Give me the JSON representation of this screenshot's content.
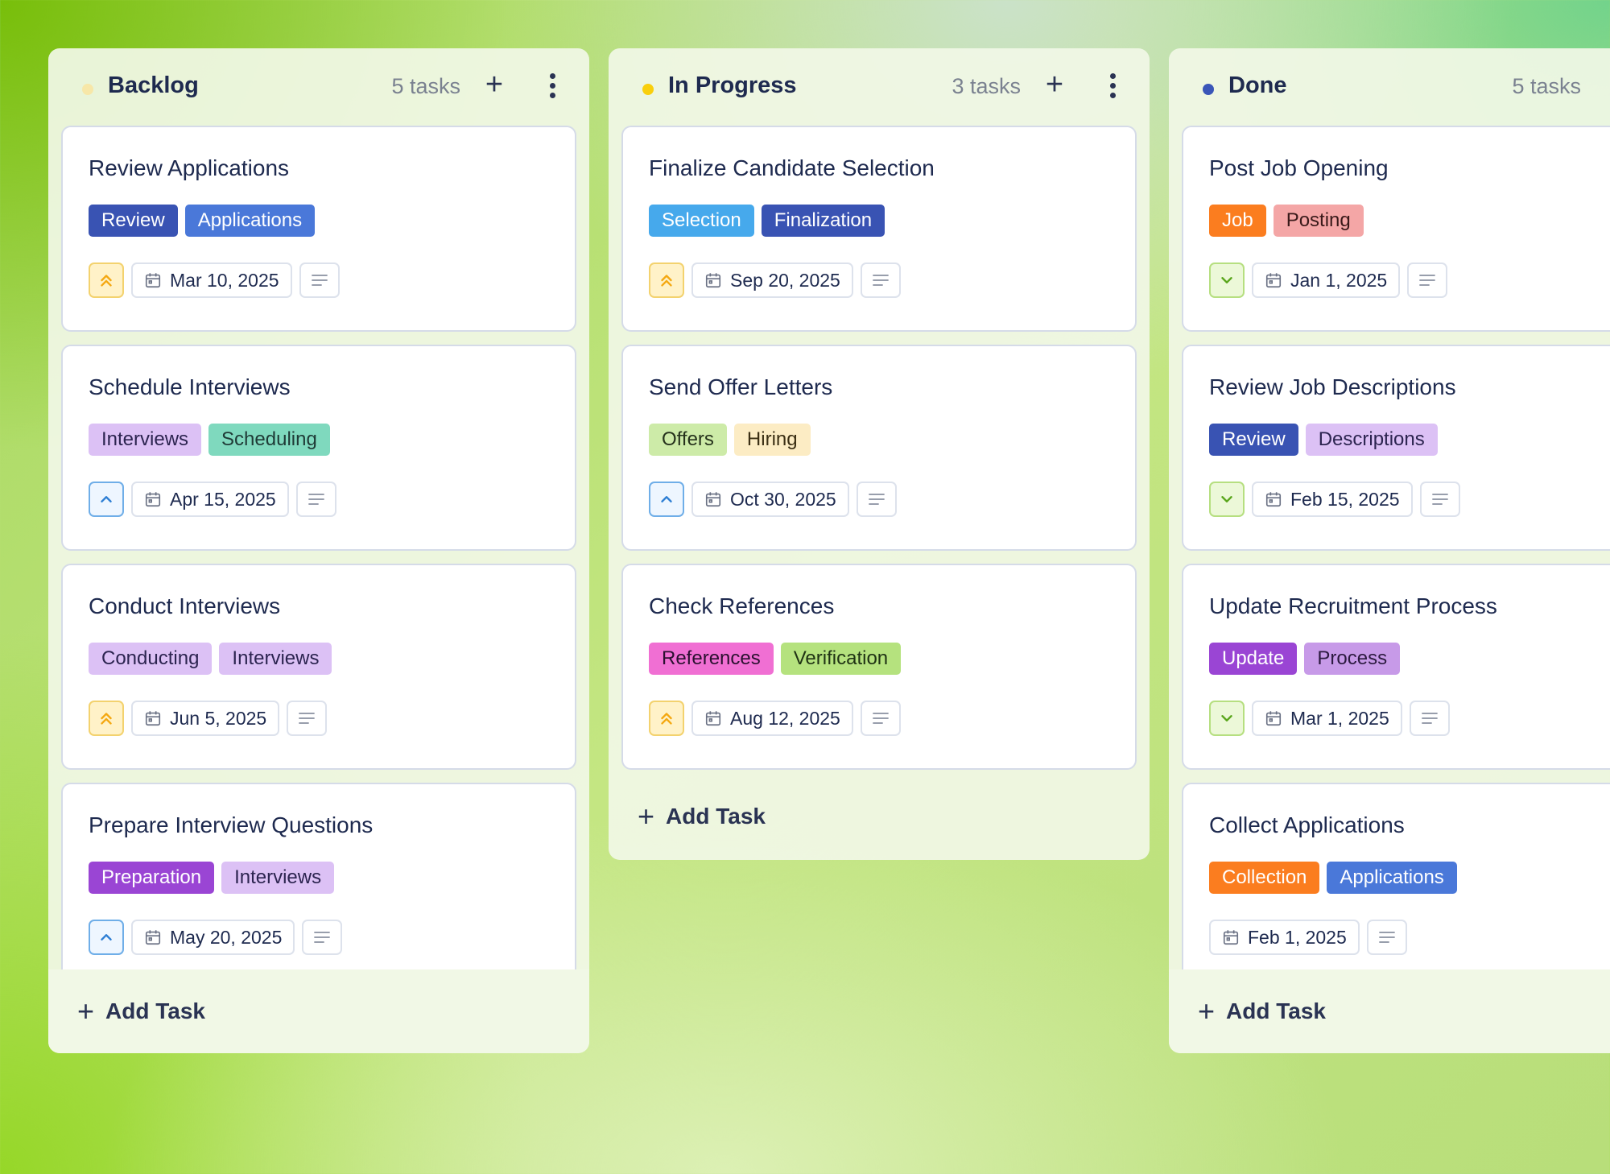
{
  "colors": {
    "backlog_dot": "#f7e7a8",
    "progress_dot": "#f9cf0c",
    "done_dot": "#3a56b8",
    "tag_review": "#3953b3",
    "tag_applications": "#4a78d9",
    "tag_interviews": "#dcc1f5",
    "tag_scheduling": "#7fd9be",
    "tag_conducting": "#dcc1f5",
    "tag_preparation": "#9a45d4",
    "tag_selection": "#46a9ec",
    "tag_finalization": "#3953b3",
    "tag_offers": "#cdeba8",
    "tag_hiring": "#fcecc4",
    "tag_references": "#f06fd3",
    "tag_verification": "#b5e27e",
    "tag_job": "#fb7d1f",
    "tag_posting": "#f4a6a6",
    "tag_descriptions": "#dcc1f5",
    "tag_update": "#9a45d4",
    "tag_process": "#c79ae8",
    "tag_collection": "#fb7d1f"
  },
  "columns": {
    "backlog": {
      "title": "Backlog",
      "count": "5 tasks",
      "add_task": "Add Task",
      "cards": [
        {
          "title": "Review Applications",
          "tags": [
            "Review",
            "Applications"
          ],
          "priority": "high",
          "date": "Mar 10, 2025"
        },
        {
          "title": "Schedule Interviews",
          "tags": [
            "Interviews",
            "Scheduling"
          ],
          "priority": "medium",
          "date": "Apr 15, 2025"
        },
        {
          "title": "Conduct Interviews",
          "tags": [
            "Conducting",
            "Interviews"
          ],
          "priority": "high",
          "date": "Jun 5, 2025"
        },
        {
          "title": "Prepare Interview Questions",
          "tags": [
            "Preparation",
            "Interviews"
          ],
          "priority": "medium",
          "date": "May 20, 2025"
        }
      ]
    },
    "progress": {
      "title": "In Progress",
      "count": "3 tasks",
      "add_task": "Add Task",
      "cards": [
        {
          "title": "Finalize Candidate Selection",
          "tags": [
            "Selection",
            "Finalization"
          ],
          "priority": "high",
          "date": "Sep 20, 2025"
        },
        {
          "title": "Send Offer Letters",
          "tags": [
            "Offers",
            "Hiring"
          ],
          "priority": "medium",
          "date": "Oct 30, 2025"
        },
        {
          "title": "Check References",
          "tags": [
            "References",
            "Verification"
          ],
          "priority": "high",
          "date": "Aug 12, 2025"
        }
      ]
    },
    "done": {
      "title": "Done",
      "count": "5 tasks",
      "add_task": "Add Task",
      "cards": [
        {
          "title": "Post Job Opening",
          "tags": [
            "Job",
            "Posting"
          ],
          "priority": "low",
          "date": "Jan 1, 2025"
        },
        {
          "title": "Review Job Descriptions",
          "tags": [
            "Review",
            "Descriptions"
          ],
          "priority": "low",
          "date": "Feb 15, 2025"
        },
        {
          "title": "Update Recruitment Process",
          "tags": [
            "Update",
            "Process"
          ],
          "priority": "low",
          "date": "Mar 1, 2025"
        },
        {
          "title": "Collect Applications",
          "tags": [
            "Collection",
            "Applications"
          ],
          "priority": "none",
          "date": "Feb 1, 2025"
        }
      ]
    }
  }
}
